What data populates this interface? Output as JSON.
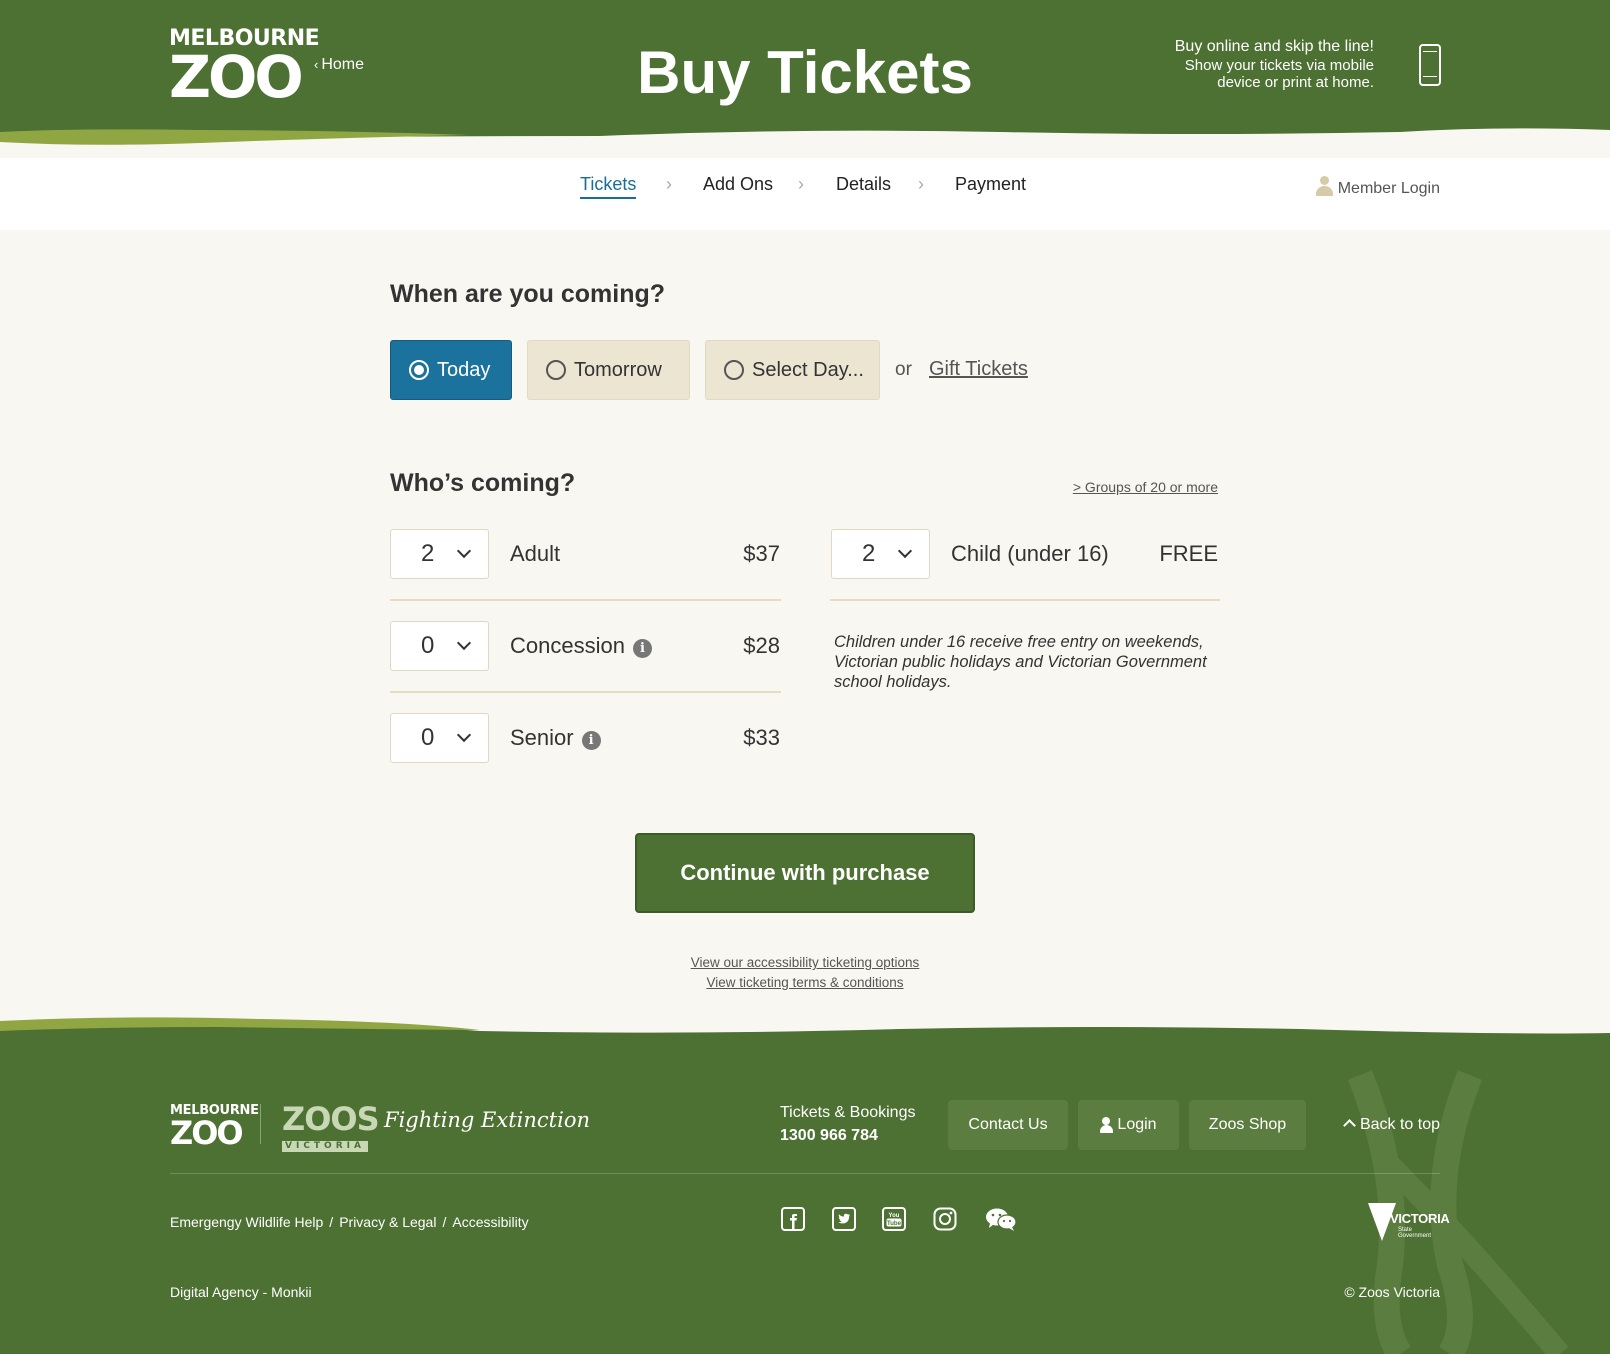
{
  "header": {
    "logo_line1": "MELBOURNE",
    "logo_line2": "ZOO",
    "home_label": "Home",
    "page_title": "Buy Tickets",
    "promo_line1": "Buy online and skip the line!",
    "promo_line2": "Show your tickets via mobile",
    "promo_line3": "device or print at home.",
    "icon": "phone-icon"
  },
  "steps": {
    "items": [
      {
        "label": "Tickets",
        "active": true
      },
      {
        "label": "Add Ons",
        "active": false
      },
      {
        "label": "Details",
        "active": false
      },
      {
        "label": "Payment",
        "active": false
      }
    ],
    "member_login": "Member Login"
  },
  "when": {
    "heading": "When are you coming?",
    "options": [
      {
        "label": "Today",
        "selected": true
      },
      {
        "label": "Tomorrow",
        "selected": false
      },
      {
        "label": "Select Day...",
        "selected": false
      }
    ],
    "or_text": "or",
    "gift_link": "Gift Tickets"
  },
  "who": {
    "heading": "Who’s coming?",
    "groups_link": "> Groups of 20 or more",
    "tickets": [
      {
        "qty": "2",
        "label": "Adult",
        "price": "$37",
        "info": false
      },
      {
        "qty": "0",
        "label": "Concession",
        "price": "$28",
        "info": true
      },
      {
        "qty": "0",
        "label": "Senior",
        "price": "$33",
        "info": true
      },
      {
        "qty": "2",
        "label": "Child (under 16)",
        "price": "FREE",
        "info": false
      }
    ],
    "child_note": "Children under 16 receive free entry on weekends, Victorian public holidays and Victorian Government school holidays."
  },
  "continue_label": "Continue with purchase",
  "links": {
    "accessibility": "View our accessibility ticketing options",
    "terms": "View ticketing terms & conditions"
  },
  "footer": {
    "logo_line1": "MELBOURNE",
    "logo_line2": "ZOO",
    "zv_line1": "ZOOS",
    "zv_line2": "VICTORIA",
    "tagline": "Fighting Extinction",
    "tb_label": "Tickets & Bookings",
    "tb_phone": "1300 966 784",
    "contact": "Contact Us",
    "login": "Login",
    "shop": "Zoos Shop",
    "back_to_top": "Back to top",
    "links": [
      "Emergengy Wildlife Help",
      "Privacy & Legal",
      "Accessibility"
    ],
    "social": [
      "facebook-icon",
      "twitter-icon",
      "youtube-icon",
      "instagram-icon",
      "wechat-icon"
    ],
    "vic_main": "VICTORIA",
    "vic_sub": "State Government",
    "agency": "Digital Agency - Monkii",
    "copyright": "© Zoos Victoria"
  },
  "colors": {
    "brand_green": "#4d7033",
    "accent_blue": "#1b739d",
    "light_green": "#8fa643",
    "beige": "#ece5d2"
  }
}
